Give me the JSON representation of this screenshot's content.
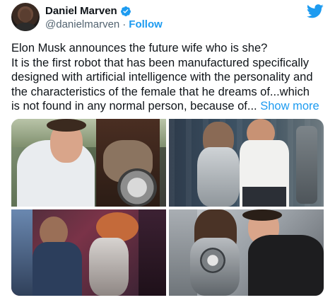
{
  "author": {
    "name": "Daniel Marven",
    "handle": "@danielmarven",
    "separator": "·",
    "follow_label": "Follow"
  },
  "icons": {
    "verified": "verified-badge-icon",
    "platform": "twitter-bird-icon"
  },
  "colors": {
    "accent": "#1d9bf0",
    "text": "#0f1419",
    "secondary": "#536471"
  },
  "tweet": {
    "lines": [
      "Elon Musk announces the future wife who is she?",
      "It is the first robot that has been manufactured specifically",
      "designed with artificial intelligence with the personality and",
      "the characteristics of the female that he dreams of...which",
      "is not found in any normal person, because of..."
    ],
    "show_more": "Show more"
  }
}
